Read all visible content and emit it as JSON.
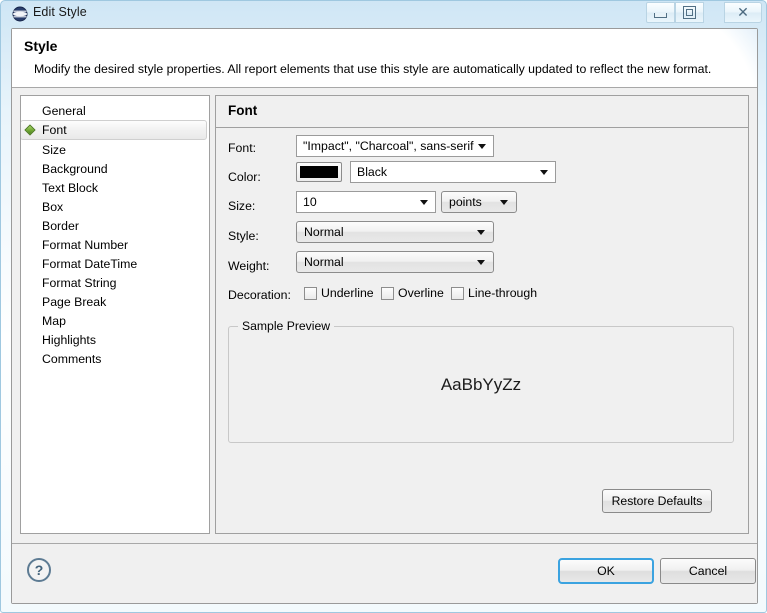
{
  "window": {
    "title": "Edit Style",
    "icon": "app-globe-icon",
    "controls": {
      "minimize": "Minimize",
      "restore": "Restore",
      "close": "Close",
      "close_glyph": "✕"
    }
  },
  "header": {
    "title": "Style",
    "description": "Modify the desired style properties. All report elements that use this style are automatically updated to reflect the new format."
  },
  "sidebar": {
    "items": [
      {
        "label": "General",
        "selected": false
      },
      {
        "label": "Font",
        "selected": true
      },
      {
        "label": "Size",
        "selected": false
      },
      {
        "label": "Background",
        "selected": false
      },
      {
        "label": "Text Block",
        "selected": false
      },
      {
        "label": "Box",
        "selected": false
      },
      {
        "label": "Border",
        "selected": false
      },
      {
        "label": "Format Number",
        "selected": false
      },
      {
        "label": "Format DateTime",
        "selected": false
      },
      {
        "label": "Format String",
        "selected": false
      },
      {
        "label": "Page Break",
        "selected": false
      },
      {
        "label": "Map",
        "selected": false
      },
      {
        "label": "Highlights",
        "selected": false
      },
      {
        "label": "Comments",
        "selected": false
      }
    ]
  },
  "content": {
    "section_title": "Font",
    "fields": {
      "font": {
        "label": "Font:",
        "value": "\"Impact\", \"Charcoal\", sans-serif"
      },
      "color": {
        "label": "Color:",
        "swatch_hex": "#000000",
        "value": "Black"
      },
      "size": {
        "label": "Size:",
        "value": "10",
        "units_value": "points"
      },
      "style": {
        "label": "Style:",
        "value": "Normal"
      },
      "weight": {
        "label": "Weight:",
        "value": "Normal"
      },
      "decoration": {
        "label": "Decoration:",
        "options": [
          {
            "label": "Underline",
            "checked": false
          },
          {
            "label": "Overline",
            "checked": false
          },
          {
            "label": "Line-through",
            "checked": false
          }
        ]
      }
    },
    "preview": {
      "legend": "Sample Preview",
      "sample_text": "AaBbYyZz"
    },
    "restore_defaults_label": "Restore Defaults"
  },
  "footer": {
    "help_glyph": "?",
    "ok_label": "OK",
    "cancel_label": "Cancel"
  },
  "colors": {
    "accent_focus": "#3ba3e0",
    "selected_bullet": "#6fa832",
    "titlebar_top": "#cfe6f5"
  }
}
